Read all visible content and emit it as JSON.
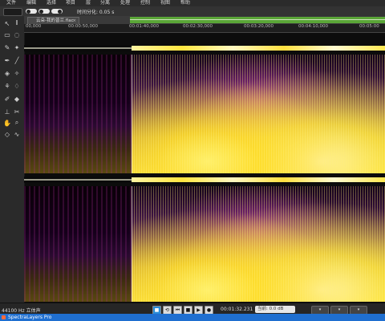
{
  "menu": [
    "文件",
    "编辑",
    "选择",
    "项目",
    "层",
    "分离",
    "处理",
    "控制",
    "视图",
    "帮助"
  ],
  "toolbar": {
    "time_label": "时间分化: 0.05 s"
  },
  "tab": {
    "title": "云朵-我的普兰.flac",
    "close": "×"
  },
  "ruler": {
    "ticks": [
      "00,000",
      "00:00:50,000",
      "00:01:40,000",
      "00:02:30,000",
      "00:03:20,000",
      "00:04:10,000",
      "00:05:00"
    ]
  },
  "tools": [
    "cursor-icon",
    "text-icon",
    "rect-select-icon",
    "lasso-icon",
    "brush-icon",
    "wand-icon",
    "pen-icon",
    "eraser-icon",
    "clone-icon",
    "fill-icon",
    "hand-icon",
    "zoom-icon",
    "layers-icon"
  ],
  "status": {
    "format": "44100 Hz 立体声",
    "time": "00:01:32.231",
    "zoom": "当前: 0.0 dB"
  },
  "app": {
    "name": "SpectraLayers Pro"
  }
}
